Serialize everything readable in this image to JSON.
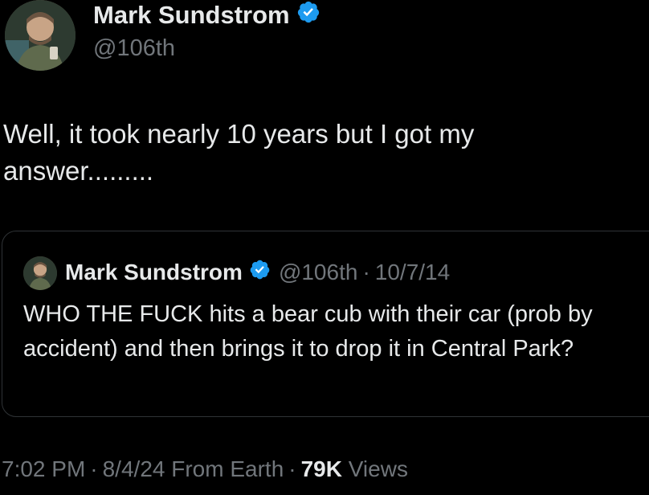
{
  "author": {
    "name": "Mark Sundstrom",
    "handle": "@106th",
    "verified": true
  },
  "tweet": {
    "text": "Well, it took nearly 10 years but I got my answer........."
  },
  "quoted_tweet": {
    "name": "Mark Sundstrom",
    "handle": "@106th",
    "separator": "·",
    "date": "10/7/14",
    "text": "WHO THE FUCK hits a bear cub with their car (prob by accident) and then brings it to drop it in Central Park?"
  },
  "meta": {
    "time": "7:02 PM",
    "separator": "·",
    "date": "8/4/24",
    "source": "From Earth",
    "views_count": "79K",
    "views_label": "Views"
  },
  "colors": {
    "background": "#000000",
    "primary_text": "#e7e9ea",
    "secondary_text": "#71767b",
    "verified_badge": "#1d9bf0",
    "border": "#2f3336"
  },
  "icons": {
    "verified": "verified-badge-icon"
  }
}
